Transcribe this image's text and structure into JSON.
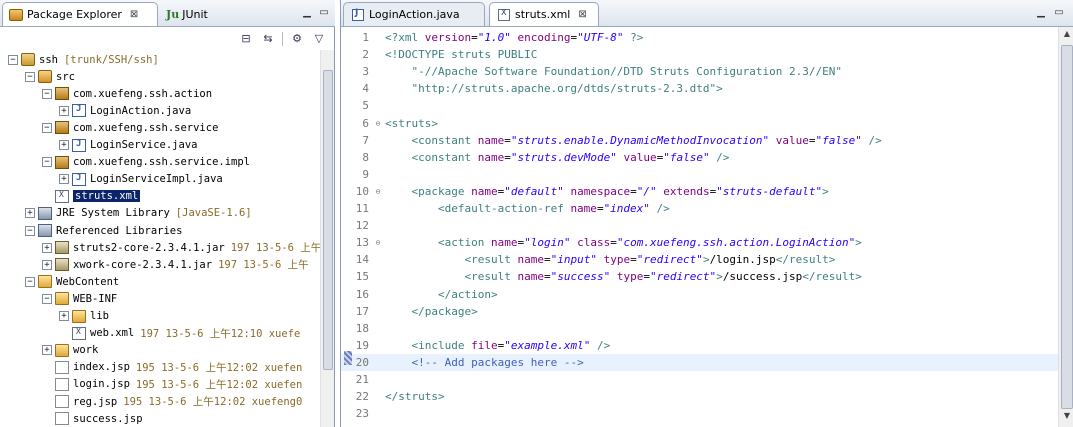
{
  "left_panel": {
    "tabs": [
      {
        "label": "Package Explorer",
        "close": "⊠"
      },
      {
        "label": "JUnit",
        "icon_text": "Ju"
      }
    ],
    "toolbar": [
      "collapse-all",
      "link-with-editor",
      "view-menu"
    ],
    "tree": [
      {
        "label": "ssh",
        "meta": "[trunk/SSH/ssh]",
        "icon": "project-icon",
        "twist": "−",
        "depth": 0
      },
      {
        "label": "src",
        "meta": "",
        "icon": "source-folder-icon",
        "twist": "−",
        "depth": 1
      },
      {
        "label": "com.xuefeng.ssh.action",
        "meta": "",
        "icon": "package-icon",
        "twist": "−",
        "depth": 2
      },
      {
        "label": "LoginAction.java",
        "meta": "",
        "icon": "java-file-icon",
        "twist": "+",
        "depth": 3
      },
      {
        "label": "com.xuefeng.ssh.service",
        "meta": "",
        "icon": "package-icon",
        "twist": "−",
        "depth": 2
      },
      {
        "label": "LoginService.java",
        "meta": "",
        "icon": "java-file-icon",
        "twist": "+",
        "depth": 3
      },
      {
        "label": "com.xuefeng.ssh.service.impl",
        "meta": "",
        "icon": "package-icon",
        "twist": "−",
        "depth": 2
      },
      {
        "label": "LoginServiceImpl.java",
        "meta": "",
        "icon": "java-file-icon",
        "twist": "+",
        "depth": 3
      },
      {
        "label": "struts.xml",
        "meta": "",
        "icon": "xml-file-icon",
        "twist": "",
        "depth": 2,
        "selected": true
      },
      {
        "label": "JRE System Library",
        "meta": "[JavaSE-1.6]",
        "icon": "library-icon",
        "twist": "+",
        "depth": 1
      },
      {
        "label": "Referenced Libraries",
        "meta": "",
        "icon": "library-icon",
        "twist": "−",
        "depth": 1
      },
      {
        "label": "struts2-core-2.3.4.1.jar",
        "meta": "197  13-5-6 上午",
        "icon": "jar-icon",
        "twist": "+",
        "depth": 2
      },
      {
        "label": "xwork-core-2.3.4.1.jar",
        "meta": "197  13-5-6 上午",
        "icon": "jar-icon",
        "twist": "+",
        "depth": 2
      },
      {
        "label": "WebContent",
        "meta": "",
        "icon": "folder-icon",
        "twist": "−",
        "depth": 1
      },
      {
        "label": "WEB-INF",
        "meta": "",
        "icon": "folder-icon",
        "twist": "−",
        "depth": 2
      },
      {
        "label": "lib",
        "meta": "",
        "icon": "folder-icon",
        "twist": "+",
        "depth": 3
      },
      {
        "label": "web.xml",
        "meta": "197  13-5-6 上午12:10  xuefe",
        "icon": "xml-file-icon",
        "twist": "",
        "depth": 3
      },
      {
        "label": "work",
        "meta": "",
        "icon": "folder-icon",
        "twist": "+",
        "depth": 2
      },
      {
        "label": "index.jsp",
        "meta": "195  13-5-6 上午12:02  xuefen",
        "icon": "file-icon",
        "twist": "",
        "depth": 2
      },
      {
        "label": "login.jsp",
        "meta": "195  13-5-6 上午12:02  xuefen",
        "icon": "file-icon",
        "twist": "",
        "depth": 2
      },
      {
        "label": "reg.jsp",
        "meta": "195  13-5-6 上午12:02  xuefeng0",
        "icon": "file-icon",
        "twist": "",
        "depth": 2
      },
      {
        "label": "success.jsp",
        "meta": "",
        "icon": "file-icon",
        "twist": "",
        "depth": 2
      }
    ]
  },
  "editor": {
    "tabs": [
      {
        "label": "LoginAction.java",
        "active": false
      },
      {
        "label": "struts.xml",
        "active": true,
        "close": "⊠"
      }
    ],
    "current_line": 20,
    "lines": [
      {
        "n": "1",
        "fold": "",
        "tokens": [
          [
            "pi",
            "<?"
          ],
          [
            "tag",
            "xml "
          ],
          [
            "attr",
            "version"
          ],
          [
            "txt",
            "="
          ],
          [
            "val",
            "\"1.0\""
          ],
          [
            "txt",
            " "
          ],
          [
            "attr",
            "encoding"
          ],
          [
            "txt",
            "="
          ],
          [
            "val",
            "\"UTF-8\""
          ],
          [
            "pi",
            " ?>"
          ]
        ]
      },
      {
        "n": "2",
        "fold": "",
        "tokens": [
          [
            "doc",
            "<!DOCTYPE struts PUBLIC"
          ]
        ]
      },
      {
        "n": "3",
        "fold": "",
        "tokens": [
          [
            "str",
            "    \"-//Apache Software Foundation//DTD Struts Configuration 2.3//EN\""
          ]
        ]
      },
      {
        "n": "4",
        "fold": "",
        "tokens": [
          [
            "str",
            "    \"http://struts.apache.org/dtds/struts-2.3.dtd\">"
          ]
        ]
      },
      {
        "n": "5",
        "fold": "",
        "tokens": []
      },
      {
        "n": "6",
        "fold": "⊖",
        "tokens": [
          [
            "tag",
            "<struts>"
          ]
        ]
      },
      {
        "n": "7",
        "fold": "",
        "tokens": [
          [
            "txt",
            "    "
          ],
          [
            "tag",
            "<constant "
          ],
          [
            "attr",
            "name"
          ],
          [
            "txt",
            "="
          ],
          [
            "val",
            "\"struts.enable.DynamicMethodInvocation\""
          ],
          [
            "txt",
            " "
          ],
          [
            "attr",
            "value"
          ],
          [
            "txt",
            "="
          ],
          [
            "val",
            "\"false\""
          ],
          [
            "tag",
            " />"
          ]
        ]
      },
      {
        "n": "8",
        "fold": "",
        "tokens": [
          [
            "txt",
            "    "
          ],
          [
            "tag",
            "<constant "
          ],
          [
            "attr",
            "name"
          ],
          [
            "txt",
            "="
          ],
          [
            "val",
            "\"struts.devMode\""
          ],
          [
            "txt",
            " "
          ],
          [
            "attr",
            "value"
          ],
          [
            "txt",
            "="
          ],
          [
            "val",
            "\"false\""
          ],
          [
            "tag",
            " />"
          ]
        ]
      },
      {
        "n": "9",
        "fold": "",
        "tokens": []
      },
      {
        "n": "10",
        "fold": "⊖",
        "tokens": [
          [
            "txt",
            "    "
          ],
          [
            "tag",
            "<package "
          ],
          [
            "attr",
            "name"
          ],
          [
            "txt",
            "="
          ],
          [
            "val",
            "\"default\""
          ],
          [
            "txt",
            " "
          ],
          [
            "attr",
            "namespace"
          ],
          [
            "txt",
            "="
          ],
          [
            "val",
            "\"/\""
          ],
          [
            "txt",
            " "
          ],
          [
            "attr",
            "extends"
          ],
          [
            "txt",
            "="
          ],
          [
            "val",
            "\"struts-default\""
          ],
          [
            "tag",
            ">"
          ]
        ]
      },
      {
        "n": "11",
        "fold": "",
        "tokens": [
          [
            "txt",
            "        "
          ],
          [
            "tag",
            "<default-action-ref "
          ],
          [
            "attr",
            "name"
          ],
          [
            "txt",
            "="
          ],
          [
            "val",
            "\"index\""
          ],
          [
            "tag",
            " />"
          ]
        ]
      },
      {
        "n": "12",
        "fold": "",
        "tokens": []
      },
      {
        "n": "13",
        "fold": "⊖",
        "tokens": [
          [
            "txt",
            "        "
          ],
          [
            "tag",
            "<action "
          ],
          [
            "attr",
            "name"
          ],
          [
            "txt",
            "="
          ],
          [
            "val",
            "\"login\""
          ],
          [
            "txt",
            " "
          ],
          [
            "attr",
            "class"
          ],
          [
            "txt",
            "="
          ],
          [
            "val",
            "\"com.xuefeng.ssh.action.LoginAction\""
          ],
          [
            "tag",
            ">"
          ]
        ]
      },
      {
        "n": "14",
        "fold": "",
        "tokens": [
          [
            "txt",
            "            "
          ],
          [
            "tag",
            "<result "
          ],
          [
            "attr",
            "name"
          ],
          [
            "txt",
            "="
          ],
          [
            "val",
            "\"input\""
          ],
          [
            "txt",
            " "
          ],
          [
            "attr",
            "type"
          ],
          [
            "txt",
            "="
          ],
          [
            "val",
            "\"redirect\""
          ],
          [
            "tag",
            ">"
          ],
          [
            "txt",
            "/login.jsp"
          ],
          [
            "tag",
            "</result>"
          ]
        ]
      },
      {
        "n": "15",
        "fold": "",
        "tokens": [
          [
            "txt",
            "            "
          ],
          [
            "tag",
            "<result "
          ],
          [
            "attr",
            "name"
          ],
          [
            "txt",
            "="
          ],
          [
            "val",
            "\"success\""
          ],
          [
            "txt",
            " "
          ],
          [
            "attr",
            "type"
          ],
          [
            "txt",
            "="
          ],
          [
            "val",
            "\"redirect\""
          ],
          [
            "tag",
            ">"
          ],
          [
            "txt",
            "/success.jsp"
          ],
          [
            "tag",
            "</result>"
          ]
        ]
      },
      {
        "n": "16",
        "fold": "",
        "tokens": [
          [
            "txt",
            "        "
          ],
          [
            "tag",
            "</action>"
          ]
        ]
      },
      {
        "n": "17",
        "fold": "",
        "tokens": [
          [
            "txt",
            "    "
          ],
          [
            "tag",
            "</package>"
          ]
        ]
      },
      {
        "n": "18",
        "fold": "",
        "tokens": []
      },
      {
        "n": "19",
        "fold": "",
        "tokens": [
          [
            "txt",
            "    "
          ],
          [
            "tag",
            "<include "
          ],
          [
            "attr",
            "file"
          ],
          [
            "txt",
            "="
          ],
          [
            "val",
            "\"example.xml\""
          ],
          [
            "tag",
            " />"
          ]
        ]
      },
      {
        "n": "20",
        "fold": "",
        "tokens": [
          [
            "txt",
            "    "
          ],
          [
            "com",
            "<!-- Add packages here -->"
          ]
        ]
      },
      {
        "n": "21",
        "fold": "",
        "tokens": []
      },
      {
        "n": "22",
        "fold": "",
        "tokens": [
          [
            "tag",
            "</struts>"
          ]
        ]
      },
      {
        "n": "23",
        "fold": "",
        "tokens": []
      }
    ]
  }
}
